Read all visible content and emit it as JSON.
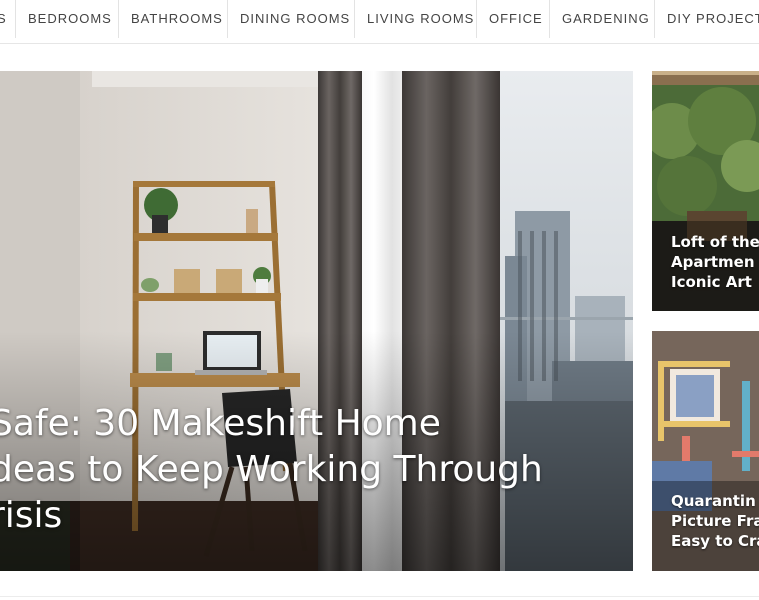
{
  "nav": {
    "items": [
      {
        "label": "S"
      },
      {
        "label": "BEDROOMS"
      },
      {
        "label": "BATHROOMS"
      },
      {
        "label": "DINING ROOMS"
      },
      {
        "label": "LIVING ROOMS"
      },
      {
        "label": "OFFICE"
      },
      {
        "label": "GARDENING"
      },
      {
        "label": "DIY PROJECTS"
      }
    ]
  },
  "hero": {
    "title_lines": [
      " Safe: 30 Makeshift Home",
      "deas to Keep Working Through",
      "risis"
    ]
  },
  "cards": [
    {
      "title_lines": [
        "Loft of the",
        "Apartmen",
        "Iconic Art"
      ]
    },
    {
      "title_lines": [
        "Quarantin",
        "Picture Fra",
        "Easy to Cra"
      ]
    }
  ]
}
